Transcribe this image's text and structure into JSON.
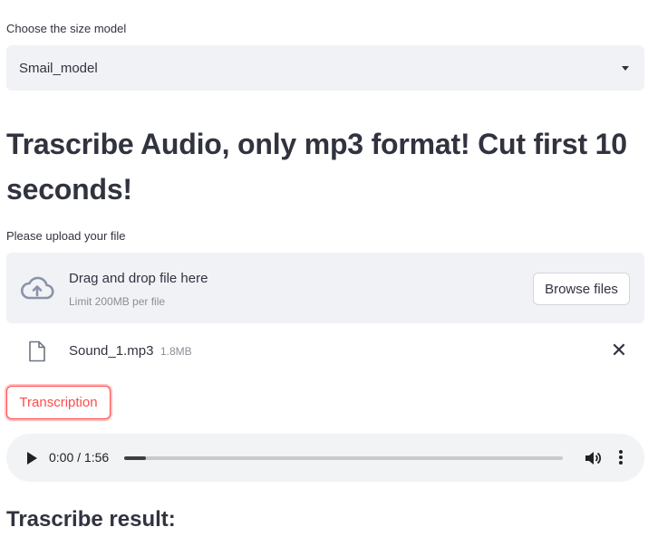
{
  "model_select": {
    "label": "Choose the size model",
    "value": "Smail_model"
  },
  "main": {
    "heading": "Trascribe Audio, only mp3 format! Cut first 10 seconds!",
    "upload_label": "Please upload your file"
  },
  "uploader": {
    "drag_text": "Drag and drop file here",
    "limit_text": "Limit 200MB per file",
    "browse_label": "Browse files",
    "icon": "cloud-upload-icon"
  },
  "file": {
    "name": "Sound_1.mp3",
    "size": "1.8MB",
    "remove_symbol": "✕"
  },
  "actions": {
    "transcription_label": "Transcription"
  },
  "audio_player": {
    "time_text": "0:00 / 1:56",
    "progress": 0.05
  },
  "result": {
    "heading": "Trascribe result:"
  },
  "colors": {
    "accent": "#ff4b4b",
    "panel": "#f0f2f6",
    "text": "#31333f"
  }
}
